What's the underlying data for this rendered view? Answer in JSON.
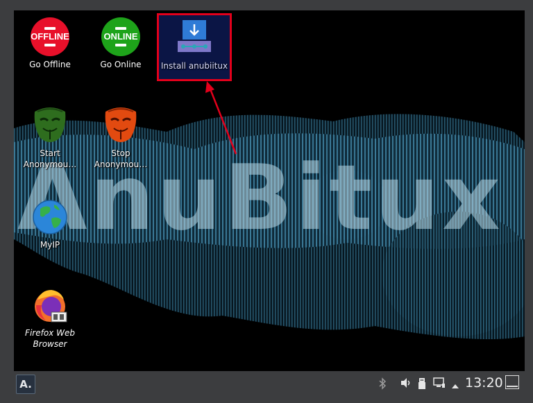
{
  "desktop": {
    "wallpaper_text": "AnuBitux",
    "icons": [
      {
        "label": "Go Offline",
        "badge": "OFFLINE",
        "color": "#e8102a"
      },
      {
        "label": "Go Online",
        "badge": "ONLINE",
        "color": "#1ea31a"
      },
      {
        "label": "Install anubiitux"
      },
      {
        "label_line1": "Start",
        "label_line2": "Anonymou…"
      },
      {
        "label_line1": "Stop",
        "label_line2": "Anonymou…"
      },
      {
        "label": "MyIP"
      },
      {
        "label_line1": "Firefox Web",
        "label_line2": "Browser"
      }
    ],
    "highlight_color": "#e3001b"
  },
  "taskbar": {
    "launcher_label": "A.",
    "clock": "13:20",
    "tray_icons": [
      "bluetooth-icon",
      "volume-icon",
      "usb-icon",
      "network-icon",
      "expand-tray-icon"
    ]
  }
}
